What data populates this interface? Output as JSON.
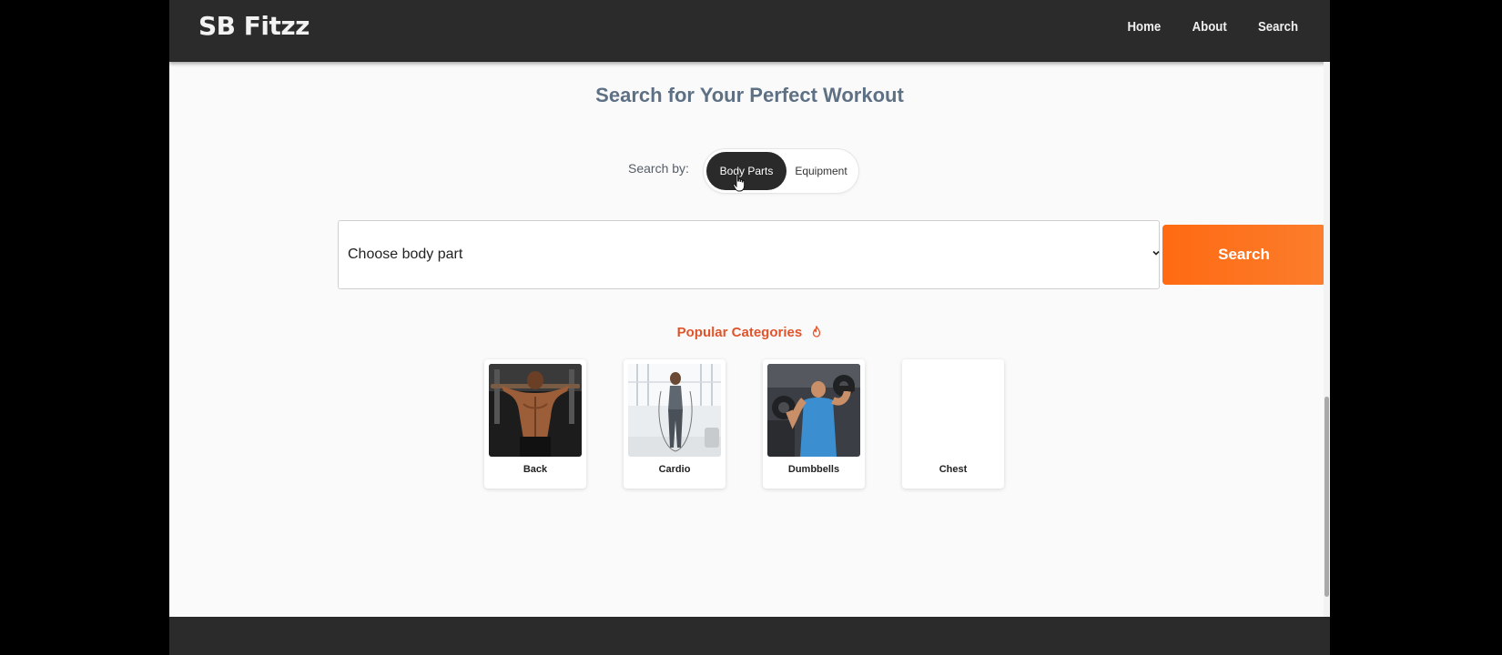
{
  "nav": {
    "brand": "SB Fitzz",
    "links": [
      "Home",
      "About",
      "Search"
    ]
  },
  "main": {
    "title": "Search for Your Perfect Workout",
    "search_by_label": "Search by:",
    "toggle": {
      "active": "Body Parts",
      "inactive": "Equipment"
    },
    "select_value": "Choose body part",
    "search_button": "Search",
    "popular_heading": "Popular Categories",
    "categories": [
      {
        "label": "Back"
      },
      {
        "label": "Cardio"
      },
      {
        "label": "Dumbbells"
      },
      {
        "label": "Chest"
      }
    ]
  },
  "colors": {
    "navbar": "#2b2b2b",
    "accent": "#ff6a12",
    "title": "#5e7184",
    "popular": "#e0542b"
  },
  "icons": {
    "cursor": "hand-pointer-icon",
    "select": "chevron-down-icon",
    "popular": "fire-icon"
  }
}
